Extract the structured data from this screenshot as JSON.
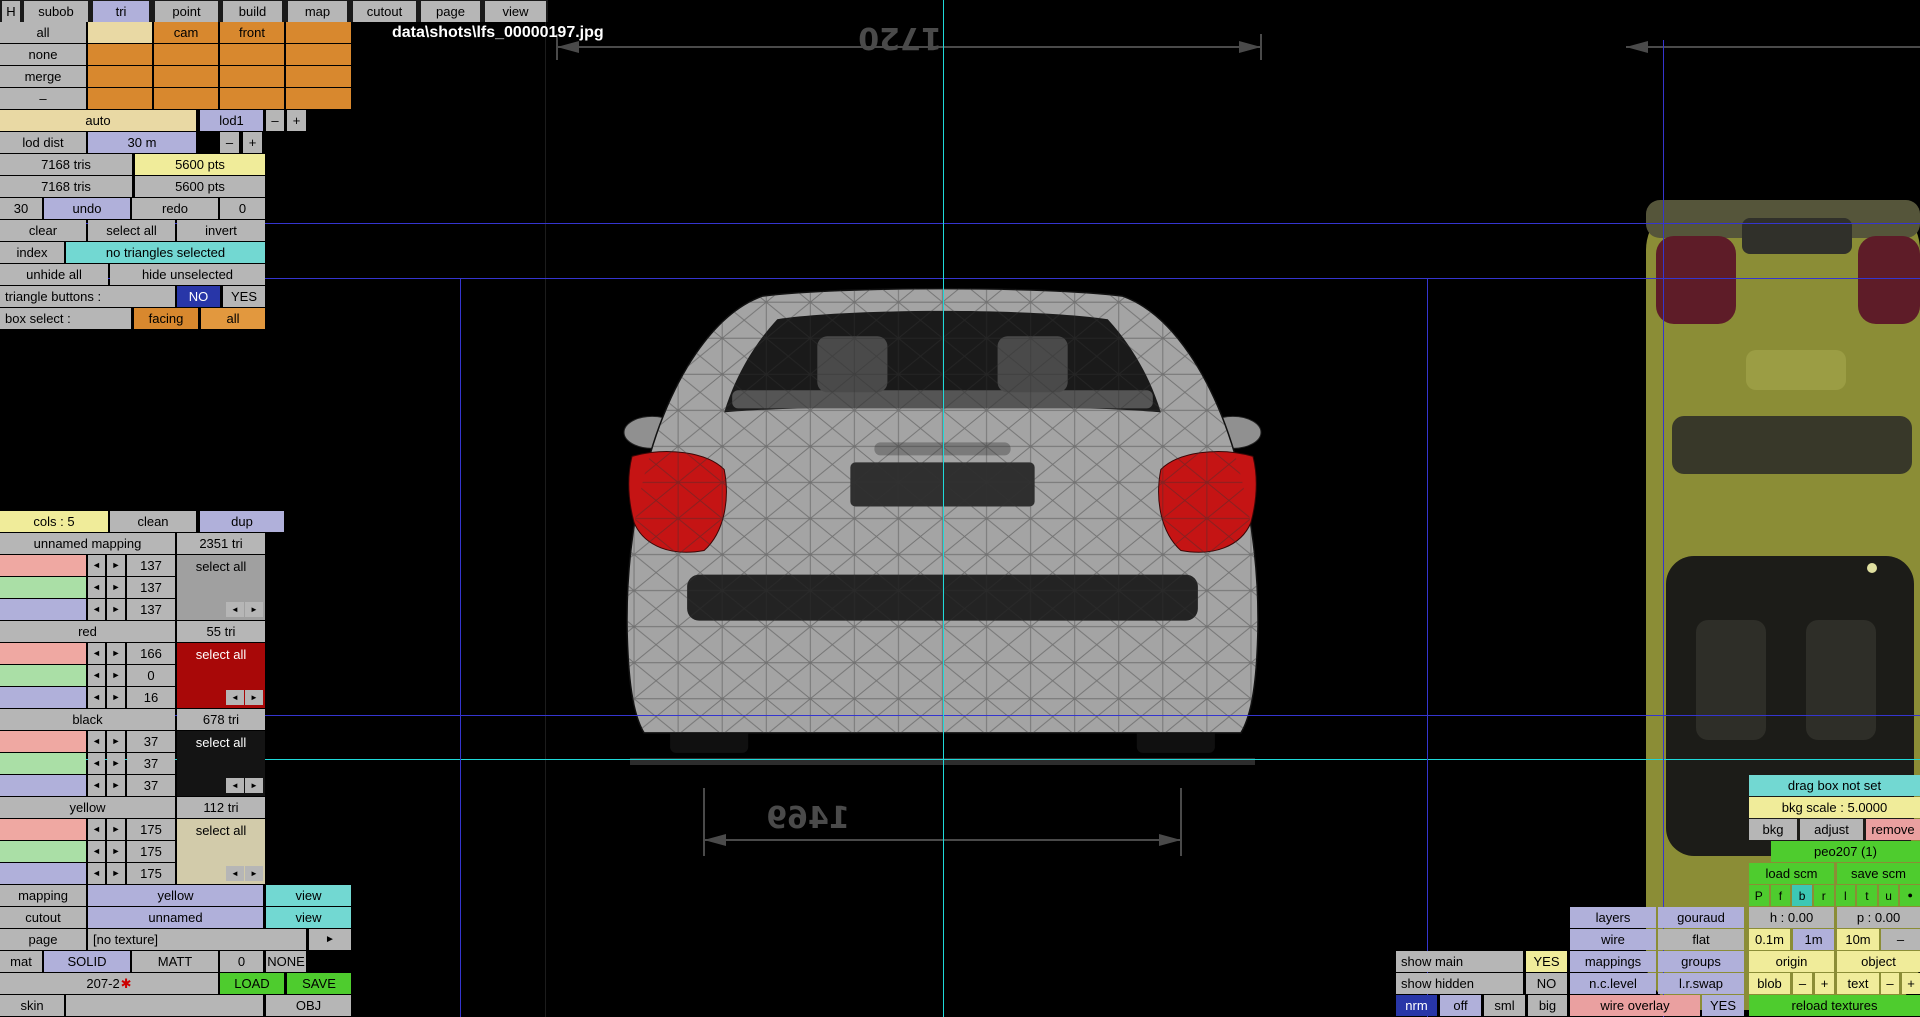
{
  "icons": {
    "left": "◄",
    "right": "►",
    "dot": "●",
    "asterisk": "✱",
    "arrow_right": "►"
  },
  "menu": {
    "items": [
      "H",
      "subob",
      "tri",
      "point",
      "build",
      "map",
      "cutout",
      "page",
      "view"
    ]
  },
  "title": "data\\shots\\lfs_00000197.jpg",
  "colors": {
    "accent_orange": "#d8882e",
    "accent_lavender": "#b0b0da",
    "accent_yellow": "#f0ec9a",
    "accent_cyan": "#72d8d2",
    "accent_green": "#4ecc2e",
    "grid_blue": "#3535cf",
    "grid_cyan": "#1fd9d9",
    "select_red": "#a80808",
    "select_black": "#141414"
  },
  "subob_panel": {
    "all": "all",
    "none": "none",
    "merge": "merge",
    "dash": "–",
    "cam": "cam",
    "front": "front",
    "auto": "auto",
    "lod": "lod1",
    "minus": "–",
    "plus": "+",
    "lod_dist_label": "lod dist",
    "lod_dist_value": "30 m",
    "stats": [
      {
        "tris": "7168 tris",
        "pts": "5600 pts"
      },
      {
        "tris": "7168 tris",
        "pts": "5600 pts"
      }
    ],
    "undo_count": "30",
    "undo": "undo",
    "redo": "redo",
    "redo_count": "0",
    "clear": "clear",
    "select_all": "select all",
    "invert": "invert",
    "index": "index",
    "selection_status": "no triangles selected",
    "unhide_all": "unhide all",
    "hide_unselected": "hide unselected",
    "triangle_buttons_label": "triangle buttons :",
    "no": "NO",
    "yes": "YES",
    "box_select_label": "box select :",
    "facing": "facing",
    "box_all": "all"
  },
  "mappings_panel": {
    "cols": "cols : 5",
    "clean": "clean",
    "dup": "dup",
    "select_all": "select all",
    "groups": [
      {
        "name": "unnamed mapping",
        "tri": "2351 tri",
        "values": [
          "137",
          "137",
          "137"
        ]
      },
      {
        "name": "red",
        "tri": "55 tri",
        "values": [
          "166",
          "0",
          "16"
        ]
      },
      {
        "name": "black",
        "tri": "678 tri",
        "values": [
          "37",
          "37",
          "37"
        ]
      },
      {
        "name": "yellow",
        "tri": "112 tri",
        "values": [
          "175",
          "175",
          "175"
        ]
      }
    ]
  },
  "bottom_panel": {
    "mapping_label": "mapping",
    "mapping_value": "yellow",
    "view": "view",
    "cutout_label": "cutout",
    "cutout_value": "unnamed",
    "page_label": "page",
    "page_value": "[no texture]",
    "mat_label": "mat",
    "solid": "SOLID",
    "matt": "MATT",
    "zero": "0",
    "none": "NONE",
    "model_name": "207-2",
    "load": "LOAD",
    "save": "SAVE",
    "skin": "skin",
    "obj": "OBJ"
  },
  "viewport": {
    "dim_top": "1720",
    "dim_bottom": "1469"
  },
  "right_panel": {
    "drag_box": "drag box not set",
    "bkg_scale": "bkg scale : 5.0000",
    "bkg": "bkg",
    "adjust": "adjust",
    "remove": "remove",
    "model": "peo207 (1)",
    "load_scm": "load scm",
    "save_scm": "save scm",
    "view_buttons": [
      "P",
      "f",
      "b",
      "r",
      "l",
      "t",
      "u",
      "●"
    ],
    "layers": "layers",
    "gouraud": "gouraud",
    "heading": "h : 0.00",
    "pitch": "p : 0.00",
    "wire": "wire",
    "flat": "flat",
    "g01": "0.1m",
    "g1": "1m",
    "g10": "10m",
    "gminus": "–",
    "show_main": "show main",
    "show_main_value": "YES",
    "mappings": "mappings",
    "groups": "groups",
    "origin": "origin",
    "object": "object",
    "show_hidden": "show hidden",
    "show_hidden_value": "NO",
    "nc_level": "n.c.level",
    "lr_swap": "l.r.swap",
    "blob": "blob",
    "blob_minus": "–",
    "blob_plus": "+",
    "text": "text",
    "text_minus": "–",
    "text_plus": "+",
    "nrm": "nrm",
    "off": "off",
    "sml": "sml",
    "big": "big",
    "wire_overlay": "wire overlay",
    "wire_overlay_value": "YES",
    "reload_textures": "reload textures"
  }
}
